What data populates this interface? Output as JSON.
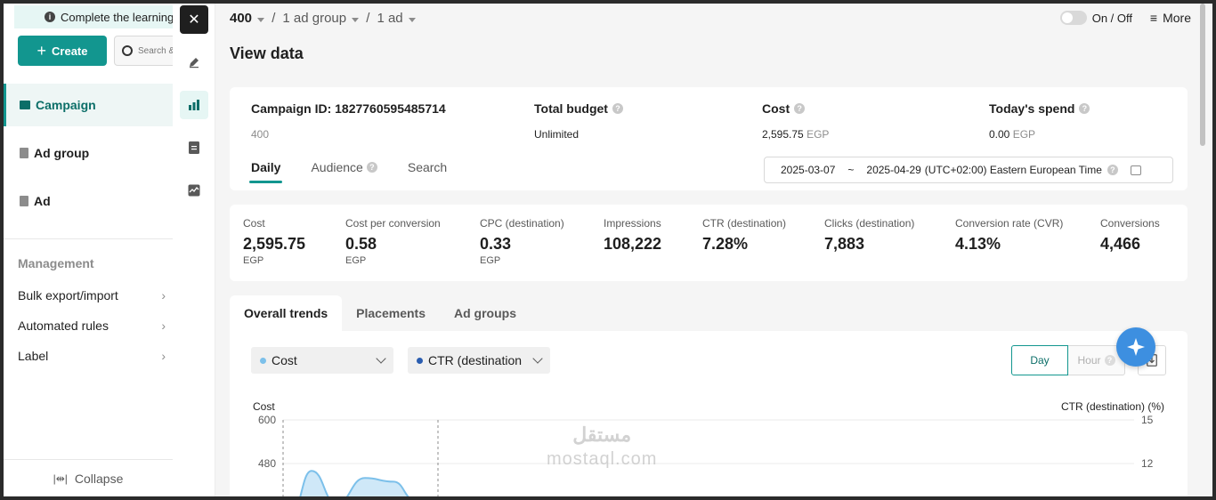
{
  "notice": {
    "text": "Complete the learning"
  },
  "sidebar": {
    "create_label": "Create",
    "search_placeholder": "Search &",
    "nav": [
      {
        "label": "Campaign"
      },
      {
        "label": "Ad group"
      },
      {
        "label": "Ad"
      }
    ],
    "management_title": "Management",
    "management_items": [
      {
        "label": "Bulk export/import"
      },
      {
        "label": "Automated rules"
      },
      {
        "label": "Label"
      }
    ],
    "collapse_label": "Collapse",
    "collapse_glyph": "|⇹|"
  },
  "rail": {
    "close_glyph": "✕"
  },
  "header": {
    "breadcrumb": [
      "400",
      "1 ad group",
      "1 ad"
    ],
    "toggle_label": "On / Off",
    "more_label": "More",
    "view_title": "View data"
  },
  "summary": {
    "campaign_id_label": "Campaign ID: 1827760595485714",
    "campaign_name": "400",
    "total_budget_label": "Total budget",
    "total_budget_value": "Unlimited",
    "cost_label": "Cost",
    "cost_value": "2,595.75",
    "cost_unit": "EGP",
    "today_spend_label": "Today's spend",
    "today_spend_value": "0.00",
    "today_spend_unit": "EGP",
    "tabs": [
      "Daily",
      "Audience",
      "Search"
    ],
    "date_start": "2025-03-07",
    "date_sep": "~",
    "date_end": "2025-04-29",
    "timezone": "(UTC+02:00) Eastern European Time"
  },
  "metrics": [
    {
      "label": "Cost",
      "value": "2,595.75",
      "unit": "EGP"
    },
    {
      "label": "Cost per conversion",
      "value": "0.58",
      "unit": "EGP"
    },
    {
      "label": "CPC (destination)",
      "value": "0.33",
      "unit": "EGP"
    },
    {
      "label": "Impressions",
      "value": "108,222",
      "unit": ""
    },
    {
      "label": "CTR (destination)",
      "value": "7.28%",
      "unit": ""
    },
    {
      "label": "Clicks (destination)",
      "value": "7,883",
      "unit": ""
    },
    {
      "label": "Conversion rate (CVR)",
      "value": "4.13%",
      "unit": ""
    },
    {
      "label": "Conversions",
      "value": "4,466",
      "unit": ""
    }
  ],
  "trend_tabs": [
    "Overall trends",
    "Placements",
    "Ad groups"
  ],
  "chart_controls": {
    "metric_left": "Cost",
    "metric_right": "CTR (destination",
    "granularity_day": "Day",
    "granularity_hour": "Hour"
  },
  "colors": {
    "accent": "#12968f",
    "series_cost": "#7cc0ea",
    "series_ctr": "#2a5db0"
  },
  "chart_data": {
    "type": "area",
    "ylabel_left": "Cost",
    "ylabel_right": "CTR (destination) (%)",
    "y_ticks_left": [
      "600",
      "480"
    ],
    "y_ticks_right": [
      "15",
      "12"
    ],
    "series": [
      {
        "name": "Cost",
        "values": [
          350,
          460,
          370,
          440,
          430,
          380
        ]
      }
    ]
  },
  "watermark": {
    "line1": "مستقل",
    "line2": "mostaql.com"
  }
}
